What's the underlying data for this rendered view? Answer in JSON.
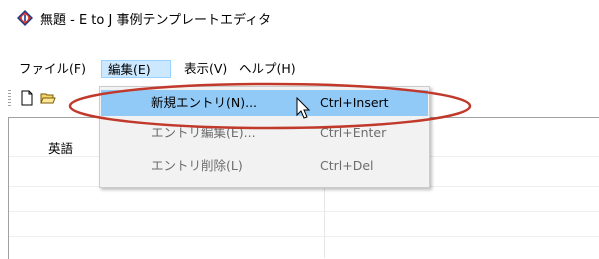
{
  "window": {
    "title": "無題 - E to J 事例テンプレートエディタ"
  },
  "menubar": {
    "file": "ファイル(F)",
    "edit": "編集(E)",
    "view": "表示(V)",
    "help": "ヘルプ(H)"
  },
  "toolbar": {
    "new_icon": "new-document-icon",
    "open_icon": "open-folder-icon"
  },
  "list": {
    "columns": [
      "英語"
    ]
  },
  "edit_menu": {
    "items": [
      {
        "label": "新規エントリ(N)...",
        "shortcut": "Ctrl+Insert",
        "state": "highlighted"
      },
      {
        "label": "エントリ編集(E)...",
        "shortcut": "Ctrl+Enter",
        "state": "disabled"
      },
      {
        "label": "エントリ削除(L)",
        "shortcut": "Ctrl+Del",
        "state": "disabled"
      }
    ]
  },
  "annotation": {
    "color": "#c0392b"
  }
}
